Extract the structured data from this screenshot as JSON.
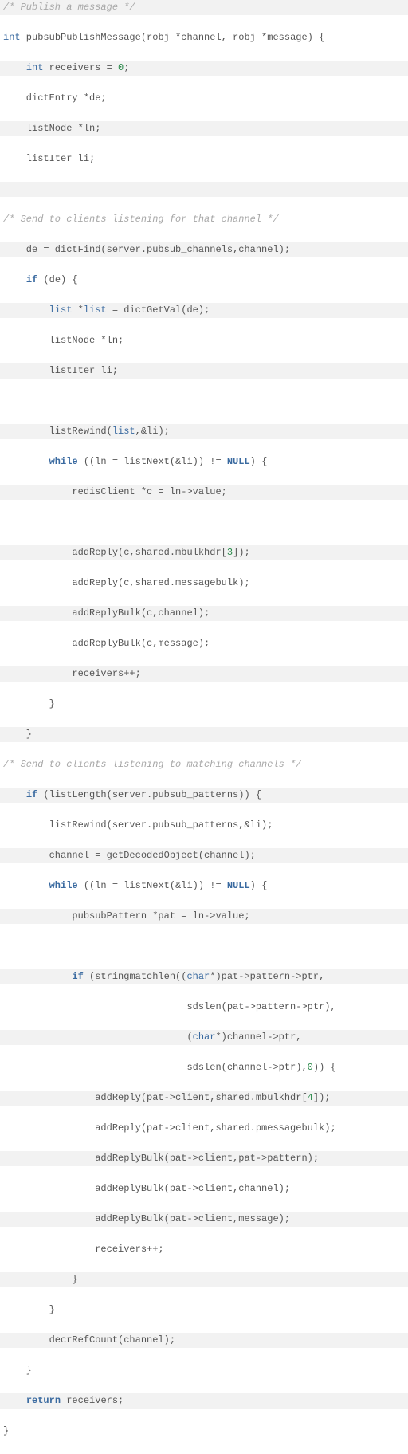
{
  "lines": [
    {
      "hl": true,
      "segments": [
        {
          "cls": "c-comment",
          "t": "/* Publish a message */"
        }
      ]
    },
    {
      "hl": false,
      "segments": [
        {
          "cls": "c-type",
          "t": "int"
        },
        {
          "cls": "c-text",
          "t": " pubsubPublishMessage(robj *channel, robj *message) {"
        }
      ]
    },
    {
      "hl": true,
      "segments": [
        {
          "cls": "c-text",
          "t": "    "
        },
        {
          "cls": "c-type",
          "t": "int"
        },
        {
          "cls": "c-text",
          "t": " receivers = "
        },
        {
          "cls": "c-num",
          "t": "0"
        },
        {
          "cls": "c-text",
          "t": ";"
        }
      ]
    },
    {
      "hl": false,
      "segments": [
        {
          "cls": "c-text",
          "t": "    dictEntry *de;"
        }
      ]
    },
    {
      "hl": true,
      "segments": [
        {
          "cls": "c-text",
          "t": "    listNode *ln;"
        }
      ]
    },
    {
      "hl": false,
      "segments": [
        {
          "cls": "c-text",
          "t": "    listIter li;"
        }
      ]
    },
    {
      "hl": true,
      "segments": [
        {
          "cls": "c-text",
          "t": " "
        }
      ]
    },
    {
      "hl": false,
      "segments": [
        {
          "cls": "c-comment",
          "t": "/* Send to clients listening for that channel */"
        }
      ]
    },
    {
      "hl": true,
      "segments": [
        {
          "cls": "c-text",
          "t": "    de = dictFind(server.pubsub_channels,channel);"
        }
      ]
    },
    {
      "hl": false,
      "segments": [
        {
          "cls": "c-text",
          "t": "    "
        },
        {
          "cls": "c-kw",
          "t": "if"
        },
        {
          "cls": "c-text",
          "t": " (de) {"
        }
      ]
    },
    {
      "hl": true,
      "segments": [
        {
          "cls": "c-text",
          "t": "        "
        },
        {
          "cls": "c-type",
          "t": "list"
        },
        {
          "cls": "c-text",
          "t": " *"
        },
        {
          "cls": "c-type",
          "t": "list"
        },
        {
          "cls": "c-text",
          "t": " = dictGetVal(de);"
        }
      ]
    },
    {
      "hl": false,
      "segments": [
        {
          "cls": "c-text",
          "t": "        listNode *ln;"
        }
      ]
    },
    {
      "hl": true,
      "segments": [
        {
          "cls": "c-text",
          "t": "        listIter li;"
        }
      ]
    },
    {
      "hl": false,
      "segments": [
        {
          "cls": "c-text",
          "t": " "
        }
      ]
    },
    {
      "hl": true,
      "segments": [
        {
          "cls": "c-text",
          "t": "        listRewind("
        },
        {
          "cls": "c-type",
          "t": "list"
        },
        {
          "cls": "c-text",
          "t": ",&li);"
        }
      ]
    },
    {
      "hl": false,
      "segments": [
        {
          "cls": "c-text",
          "t": "        "
        },
        {
          "cls": "c-kw",
          "t": "while"
        },
        {
          "cls": "c-text",
          "t": " ((ln = listNext(&li)) != "
        },
        {
          "cls": "c-const",
          "t": "NULL"
        },
        {
          "cls": "c-text",
          "t": ") {"
        }
      ]
    },
    {
      "hl": true,
      "segments": [
        {
          "cls": "c-text",
          "t": "            redisClient *c = ln->value;"
        }
      ]
    },
    {
      "hl": false,
      "segments": [
        {
          "cls": "c-text",
          "t": " "
        }
      ]
    },
    {
      "hl": true,
      "segments": [
        {
          "cls": "c-text",
          "t": "            addReply(c,shared.mbulkhdr["
        },
        {
          "cls": "c-num",
          "t": "3"
        },
        {
          "cls": "c-text",
          "t": "]);"
        }
      ]
    },
    {
      "hl": false,
      "segments": [
        {
          "cls": "c-text",
          "t": "            addReply(c,shared.messagebulk);"
        }
      ]
    },
    {
      "hl": true,
      "segments": [
        {
          "cls": "c-text",
          "t": "            addReplyBulk(c,channel);"
        }
      ]
    },
    {
      "hl": false,
      "segments": [
        {
          "cls": "c-text",
          "t": "            addReplyBulk(c,message);"
        }
      ]
    },
    {
      "hl": true,
      "segments": [
        {
          "cls": "c-text",
          "t": "            receivers++;"
        }
      ]
    },
    {
      "hl": false,
      "segments": [
        {
          "cls": "c-text",
          "t": "        }"
        }
      ]
    },
    {
      "hl": true,
      "segments": [
        {
          "cls": "c-text",
          "t": "    }"
        }
      ]
    },
    {
      "hl": false,
      "segments": [
        {
          "cls": "c-comment",
          "t": "/* Send to clients listening to matching channels */"
        }
      ]
    },
    {
      "hl": true,
      "segments": [
        {
          "cls": "c-text",
          "t": "    "
        },
        {
          "cls": "c-kw",
          "t": "if"
        },
        {
          "cls": "c-text",
          "t": " (listLength(server.pubsub_patterns)) {"
        }
      ]
    },
    {
      "hl": false,
      "segments": [
        {
          "cls": "c-text",
          "t": "        listRewind(server.pubsub_patterns,&li);"
        }
      ]
    },
    {
      "hl": true,
      "segments": [
        {
          "cls": "c-text",
          "t": "        channel = getDecodedObject(channel);"
        }
      ]
    },
    {
      "hl": false,
      "segments": [
        {
          "cls": "c-text",
          "t": "        "
        },
        {
          "cls": "c-kw",
          "t": "while"
        },
        {
          "cls": "c-text",
          "t": " ((ln = listNext(&li)) != "
        },
        {
          "cls": "c-const",
          "t": "NULL"
        },
        {
          "cls": "c-text",
          "t": ") {"
        }
      ]
    },
    {
      "hl": true,
      "segments": [
        {
          "cls": "c-text",
          "t": "            pubsubPattern *pat = ln->value;"
        }
      ]
    },
    {
      "hl": false,
      "segments": [
        {
          "cls": "c-text",
          "t": " "
        }
      ]
    },
    {
      "hl": true,
      "segments": [
        {
          "cls": "c-text",
          "t": "            "
        },
        {
          "cls": "c-kw",
          "t": "if"
        },
        {
          "cls": "c-text",
          "t": " (stringmatchlen(("
        },
        {
          "cls": "c-type",
          "t": "char"
        },
        {
          "cls": "c-text",
          "t": "*)pat->pattern->ptr,"
        }
      ]
    },
    {
      "hl": false,
      "segments": [
        {
          "cls": "c-text",
          "t": "                                sdslen(pat->pattern->ptr),"
        }
      ]
    },
    {
      "hl": true,
      "segments": [
        {
          "cls": "c-text",
          "t": "                                ("
        },
        {
          "cls": "c-type",
          "t": "char"
        },
        {
          "cls": "c-text",
          "t": "*)channel->ptr,"
        }
      ]
    },
    {
      "hl": false,
      "segments": [
        {
          "cls": "c-text",
          "t": "                                sdslen(channel->ptr),"
        },
        {
          "cls": "c-num",
          "t": "0"
        },
        {
          "cls": "c-text",
          "t": ")) {"
        }
      ]
    },
    {
      "hl": true,
      "segments": [
        {
          "cls": "c-text",
          "t": "                addReply(pat->client,shared.mbulkhdr["
        },
        {
          "cls": "c-num",
          "t": "4"
        },
        {
          "cls": "c-text",
          "t": "]);"
        }
      ]
    },
    {
      "hl": false,
      "segments": [
        {
          "cls": "c-text",
          "t": "                addReply(pat->client,shared.pmessagebulk);"
        }
      ]
    },
    {
      "hl": true,
      "segments": [
        {
          "cls": "c-text",
          "t": "                addReplyBulk(pat->client,pat->pattern);"
        }
      ]
    },
    {
      "hl": false,
      "segments": [
        {
          "cls": "c-text",
          "t": "                addReplyBulk(pat->client,channel);"
        }
      ]
    },
    {
      "hl": true,
      "segments": [
        {
          "cls": "c-text",
          "t": "                addReplyBulk(pat->client,message);"
        }
      ]
    },
    {
      "hl": false,
      "segments": [
        {
          "cls": "c-text",
          "t": "                receivers++;"
        }
      ]
    },
    {
      "hl": true,
      "segments": [
        {
          "cls": "c-text",
          "t": "            }"
        }
      ]
    },
    {
      "hl": false,
      "segments": [
        {
          "cls": "c-text",
          "t": "        }"
        }
      ]
    },
    {
      "hl": true,
      "segments": [
        {
          "cls": "c-text",
          "t": "        decrRefCount(channel);"
        }
      ]
    },
    {
      "hl": false,
      "segments": [
        {
          "cls": "c-text",
          "t": "    }"
        }
      ]
    },
    {
      "hl": true,
      "segments": [
        {
          "cls": "c-text",
          "t": "    "
        },
        {
          "cls": "c-kw",
          "t": "return"
        },
        {
          "cls": "c-text",
          "t": " receivers;"
        }
      ]
    },
    {
      "hl": false,
      "segments": [
        {
          "cls": "c-text",
          "t": "}"
        }
      ]
    }
  ]
}
